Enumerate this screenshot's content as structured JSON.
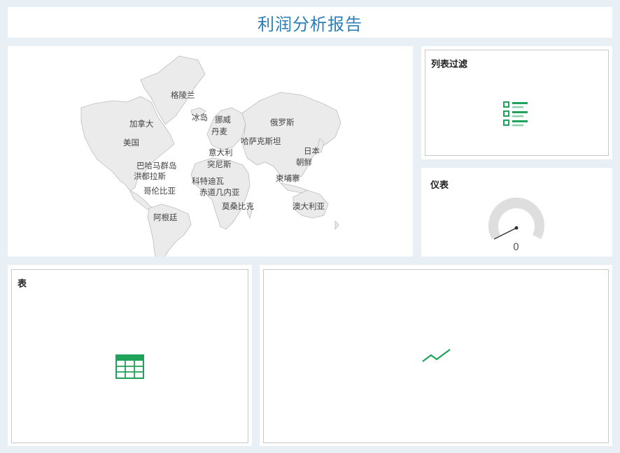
{
  "report": {
    "title": "利润分析报告"
  },
  "map": {
    "labels": [
      "格陵兰",
      "冰岛",
      "挪威",
      "加拿大",
      "丹麦",
      "俄罗斯",
      "美国",
      "哈萨克斯坦",
      "意大利",
      "日本",
      "突尼斯",
      "朝鲜",
      "巴哈马群岛",
      "洪都拉斯",
      "科特迪瓦",
      "柬埔寨",
      "哥伦比亚",
      "赤道几内亚",
      "莫桑比克",
      "澳大利亚",
      "阿根廷"
    ]
  },
  "list_filter": {
    "title": "列表过滤",
    "icon": "list-filter-icon"
  },
  "gauge": {
    "title": "仪表",
    "value": "0"
  },
  "table_widget": {
    "title": "表",
    "icon": "table-icon"
  },
  "line_widget": {
    "icon": "line-chart-icon"
  },
  "colors": {
    "accent": "#2b7fb8",
    "icon_green": "#1fa35a",
    "land": "#ebebeb",
    "background": "#e8f0f5"
  }
}
